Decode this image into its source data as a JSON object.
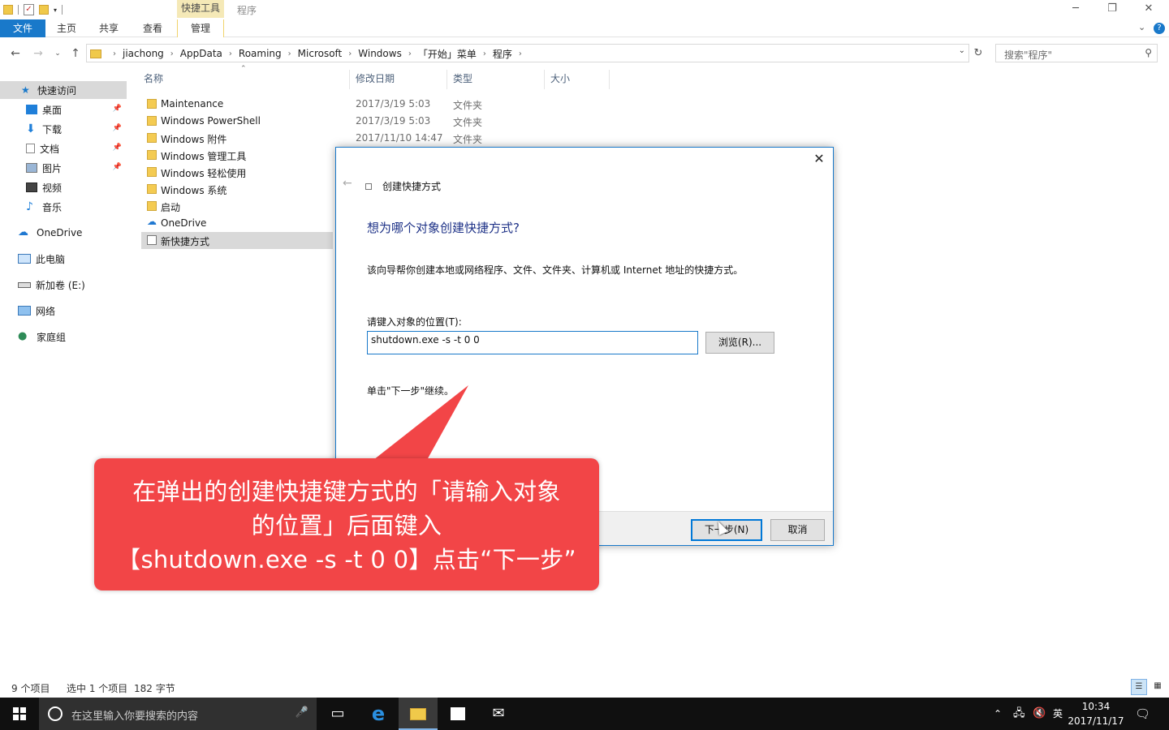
{
  "titlebar": {
    "context_tab": "快捷工具",
    "title": "程序"
  },
  "ribbon": {
    "tabs": [
      "文件",
      "主页",
      "共享",
      "查看",
      "管理"
    ]
  },
  "address": {
    "crumbs": [
      "jiachong",
      "AppData",
      "Roaming",
      "Microsoft",
      "Windows",
      "「开始」菜单",
      "程序"
    ],
    "search_placeholder": "搜索\"程序\""
  },
  "nav": {
    "items": [
      {
        "label": "快速访问",
        "icon": "star-icon"
      },
      {
        "label": "桌面",
        "icon": "desktop-icon"
      },
      {
        "label": "下载",
        "icon": "download-icon"
      },
      {
        "label": "文档",
        "icon": "document-icon"
      },
      {
        "label": "图片",
        "icon": "pictures-icon"
      },
      {
        "label": "视频",
        "icon": "video-icon"
      },
      {
        "label": "音乐",
        "icon": "music-icon"
      },
      {
        "label": "OneDrive",
        "icon": "cloud-icon"
      },
      {
        "label": "此电脑",
        "icon": "computer-icon"
      },
      {
        "label": "新加卷 (E:)",
        "icon": "drive-icon"
      },
      {
        "label": "网络",
        "icon": "network-icon"
      },
      {
        "label": "家庭组",
        "icon": "homegroup-icon"
      }
    ]
  },
  "files": {
    "columns": [
      "名称",
      "修改日期",
      "类型",
      "大小"
    ],
    "rows": [
      {
        "name": "Maintenance",
        "date": "2017/3/19 5:03",
        "type": "文件夹"
      },
      {
        "name": "Windows PowerShell",
        "date": "2017/3/19 5:03",
        "type": "文件夹"
      },
      {
        "name": "Windows 附件",
        "date": "2017/11/10 14:47",
        "type": "文件夹"
      },
      {
        "name": "Windows 管理工具",
        "date": "",
        "type": ""
      },
      {
        "name": "Windows 轻松使用",
        "date": "",
        "type": ""
      },
      {
        "name": "Windows 系统",
        "date": "",
        "type": ""
      },
      {
        "name": "启动",
        "date": "",
        "type": ""
      },
      {
        "name": "OneDrive",
        "date": "",
        "type": ""
      },
      {
        "name": "新快捷方式",
        "date": "",
        "type": ""
      }
    ]
  },
  "status": {
    "count": "9 个项目",
    "selection": "选中 1 个项目",
    "size": "182 字节"
  },
  "dialog": {
    "window_title": "创建快捷方式",
    "heading": "想为哪个对象创建快捷方式?",
    "description": "该向导帮你创建本地或网络程序、文件、文件夹、计算机或 Internet 地址的快捷方式。",
    "field_label": "请键入对象的位置(T):",
    "field_value": "shutdown.exe -s -t 0 0",
    "browse_label": "浏览(R)...",
    "hint": "单击\"下一步\"继续。",
    "next_label": "下一步(N)",
    "cancel_label": "取消"
  },
  "callout": {
    "line1": "在弹出的创建快捷键方式的「请输入对象",
    "line2": "的位置」后面键入",
    "line3": "【shutdown.exe -s -t 0 0】点击“下一步”"
  },
  "taskbar": {
    "search_placeholder": "在这里输入你要搜索的内容",
    "ime": "英",
    "time": "10:34",
    "date": "2017/11/17"
  },
  "colors": {
    "accent": "#1979ca",
    "callout": "#f24547",
    "heading": "#1e3287"
  }
}
